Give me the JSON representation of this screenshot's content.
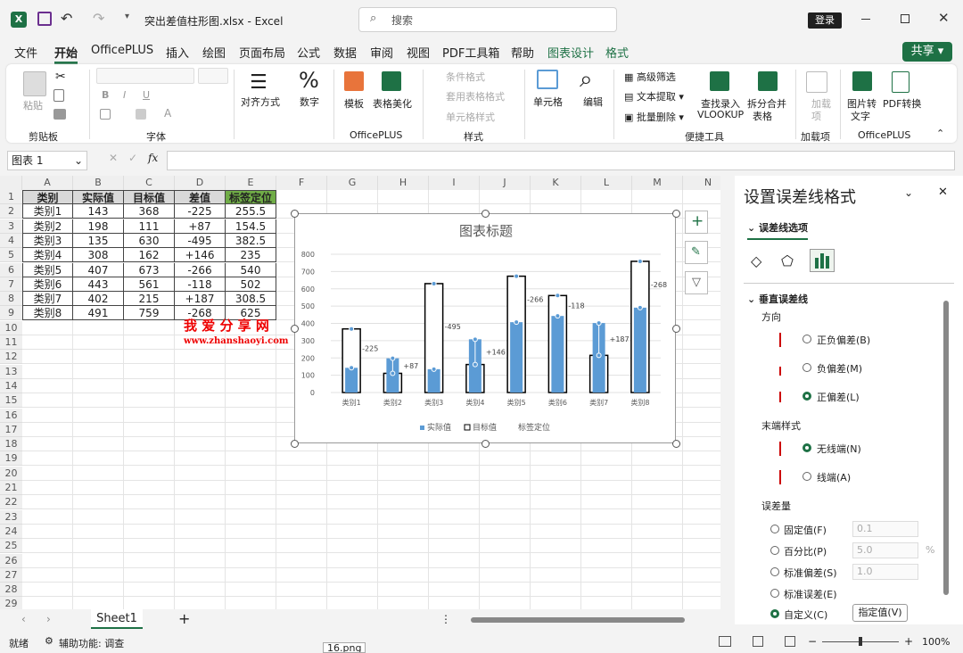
{
  "window": {
    "filename": "突出差值柱形图.xlsx",
    "app": "Excel",
    "separator": "-"
  },
  "search": {
    "placeholder": "搜索"
  },
  "account": {
    "login": "登录"
  },
  "menu": [
    "文件",
    "开始",
    "OfficePLUS",
    "插入",
    "绘图",
    "页面布局",
    "公式",
    "数据",
    "审阅",
    "视图",
    "PDF工具箱",
    "帮助",
    "图表设计",
    "格式"
  ],
  "share": "共享",
  "ribbon": {
    "clipboard": {
      "paste": "粘贴",
      "group": "剪贴板"
    },
    "font": {
      "group": "字体",
      "bold": "B",
      "italic": "I",
      "underline": "U"
    },
    "align": {
      "label": "对齐方式"
    },
    "number": {
      "label": "数字"
    },
    "officeplus": {
      "template": "模板",
      "beautify": "表格美化",
      "group": "OfficePLUS"
    },
    "styles": {
      "conditional": "条件格式",
      "table": "套用表格格式",
      "cell": "单元格样式",
      "group": "样式"
    },
    "cells": {
      "label": "单元格"
    },
    "edit": {
      "label": "编辑"
    },
    "tools": {
      "filter": "高级筛选",
      "extract": "文本提取",
      "delete": "批量删除",
      "vlookup_1": "查找录入",
      "vlookup_2": "VLOOKUP",
      "split_1": "拆分合并",
      "split_2": "表格",
      "group": "便捷工具"
    },
    "addin": {
      "label_1": "加载",
      "label_2": "项",
      "group": "加载项"
    },
    "pdf": {
      "img_1": "图片转",
      "img_2": "文字",
      "pdf_1": "PDF转换",
      "group": "OfficePLUS"
    }
  },
  "formula": {
    "namebox": "图表 1",
    "fx": "fx"
  },
  "columns": [
    "A",
    "B",
    "C",
    "D",
    "E",
    "F",
    "G",
    "H",
    "I",
    "J",
    "K",
    "L",
    "M",
    "N"
  ],
  "rows": [
    "1",
    "2",
    "3",
    "4",
    "5",
    "6",
    "7",
    "8",
    "9",
    "10",
    "11",
    "12",
    "13",
    "14",
    "15",
    "16",
    "17",
    "18",
    "19",
    "20",
    "21",
    "22",
    "23",
    "24",
    "25",
    "26",
    "27",
    "28",
    "29"
  ],
  "table": {
    "headers": [
      "类别",
      "实际值",
      "目标值",
      "差值",
      "标签定位"
    ],
    "rows": [
      [
        "类别1",
        "143",
        "368",
        "-225",
        "255.5"
      ],
      [
        "类别2",
        "198",
        "111",
        "+87",
        "154.5"
      ],
      [
        "类别3",
        "135",
        "630",
        "-495",
        "382.5"
      ],
      [
        "类别4",
        "308",
        "162",
        "+146",
        "235"
      ],
      [
        "类别5",
        "407",
        "673",
        "-266",
        "540"
      ],
      [
        "类别6",
        "443",
        "561",
        "-118",
        "502"
      ],
      [
        "类别7",
        "402",
        "215",
        "+187",
        "308.5"
      ],
      [
        "类别8",
        "491",
        "759",
        "-268",
        "625"
      ]
    ]
  },
  "watermark": {
    "line1": "我 爱 分 享 网",
    "line2": "www.zhanshaoyi.com"
  },
  "chart_data": {
    "type": "bar",
    "title": "图表标题",
    "categories": [
      "类别1",
      "类别2",
      "类别3",
      "类别4",
      "类别5",
      "类别6",
      "类别7",
      "类别8"
    ],
    "series": [
      {
        "name": "实际值",
        "values": [
          143,
          198,
          135,
          308,
          407,
          443,
          402,
          491
        ],
        "color": "#5b9bd5"
      },
      {
        "name": "目标值",
        "values": [
          368,
          111,
          630,
          162,
          673,
          561,
          215,
          759
        ],
        "color": "#000000"
      },
      {
        "name": "标签定位",
        "values": [
          255.5,
          154.5,
          382.5,
          235,
          540,
          502,
          308.5,
          625
        ]
      }
    ],
    "diff_labels": [
      "-225",
      "+87",
      "-495",
      "+146",
      "-266",
      "-118",
      "+187",
      "-268"
    ],
    "ylim": [
      0,
      800
    ],
    "yticks": [
      0,
      100,
      200,
      300,
      400,
      500,
      600,
      700,
      800
    ],
    "legend": "bottom",
    "grid": true
  },
  "pane": {
    "title": "设置误差线格式",
    "section": "误差线选项",
    "vertical": "垂直误差线",
    "direction": "方向",
    "dir_opts": [
      "正负偏差(B)",
      "负偏差(M)",
      "正偏差(L)"
    ],
    "endstyle": "末端样式",
    "end_opts": [
      "无线端(N)",
      "线端(A)"
    ],
    "amount": "误差量",
    "amt_opts": [
      "固定值(F)",
      "百分比(P)",
      "标准偏差(S)",
      "标准误差(E)",
      "自定义(C)"
    ],
    "amt_vals": [
      "0.1",
      "5.0",
      "1.0"
    ],
    "percent": "%",
    "custom_btn": "指定值(V)"
  },
  "sheet_tab": "Sheet1",
  "status": {
    "ready": "就绪",
    "access": "辅助功能: 调查",
    "zoom": "100%",
    "file": "16.png"
  }
}
